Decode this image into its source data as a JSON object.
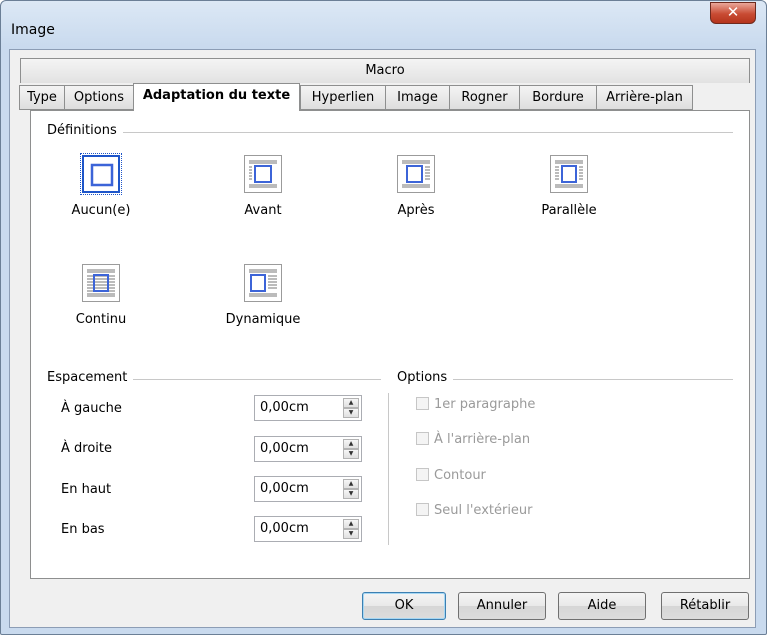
{
  "window": {
    "title": "Image",
    "close_glyph": "✕"
  },
  "tabs": {
    "top_row": "Macro",
    "items": [
      {
        "label": "Type"
      },
      {
        "label": "Options"
      },
      {
        "label": "Adaptation du texte",
        "active": true
      },
      {
        "label": "Hyperlien"
      },
      {
        "label": "Image"
      },
      {
        "label": "Rogner"
      },
      {
        "label": "Bordure"
      },
      {
        "label": "Arrière-plan"
      }
    ]
  },
  "definitions": {
    "title": "Définitions",
    "options": [
      {
        "label": "Aucun(e)",
        "icon": "wrap-none-icon",
        "selected": true
      },
      {
        "label": "Avant",
        "icon": "wrap-before-icon"
      },
      {
        "label": "Après",
        "icon": "wrap-after-icon"
      },
      {
        "label": "Parallèle",
        "icon": "wrap-parallel-icon"
      },
      {
        "label": "Continu",
        "icon": "wrap-through-icon"
      },
      {
        "label": "Dynamique",
        "icon": "wrap-dynamic-icon"
      }
    ]
  },
  "spacing": {
    "title": "Espacement",
    "fields": [
      {
        "label": "À gauche",
        "value": "0,00cm"
      },
      {
        "label": "À droite",
        "value": "0,00cm"
      },
      {
        "label": "En haut",
        "value": "0,00cm"
      },
      {
        "label": "En bas",
        "value": "0,00cm"
      }
    ]
  },
  "options": {
    "title": "Options",
    "checks": [
      {
        "label": "1er paragraphe",
        "checked": false,
        "enabled": false
      },
      {
        "label": "À l'arrière-plan",
        "checked": false,
        "enabled": false
      },
      {
        "label": "Contour",
        "checked": false,
        "enabled": false
      },
      {
        "label": "Seul l'extérieur",
        "checked": false,
        "enabled": false
      }
    ]
  },
  "buttons": {
    "ok": "OK",
    "cancel": "Annuler",
    "help": "Aide",
    "reset": "Rétablir"
  },
  "colors": {
    "accent": "#1d55c9",
    "frame_blue": "#3c64d8"
  }
}
